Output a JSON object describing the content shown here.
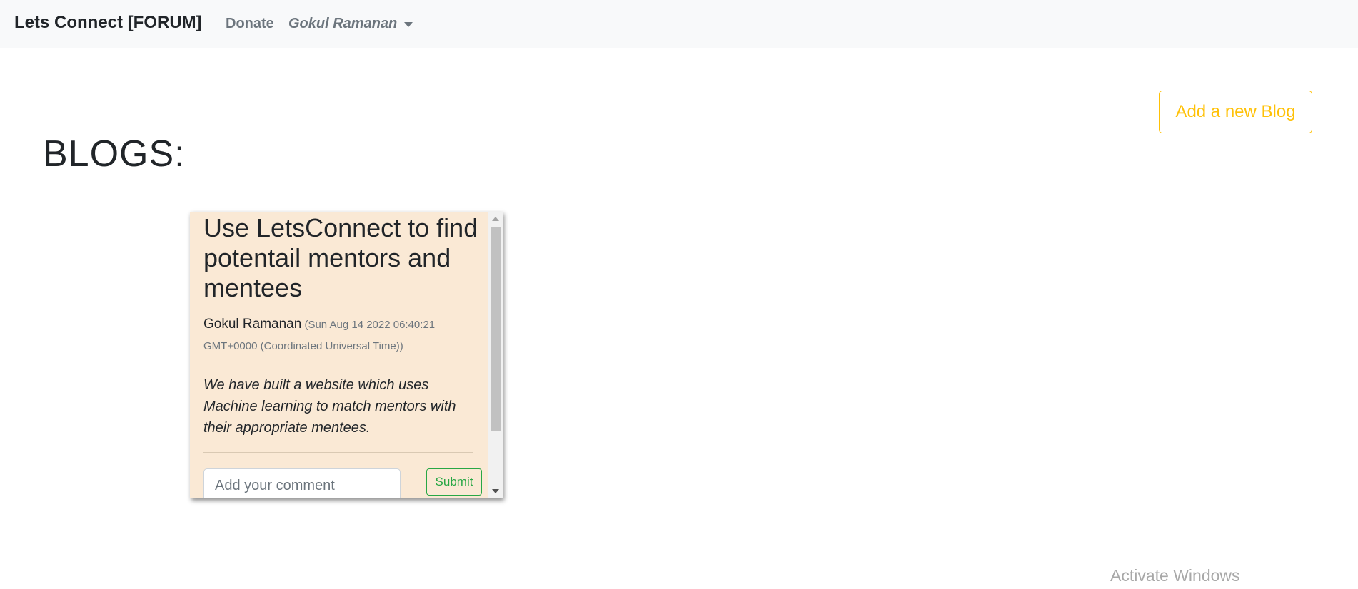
{
  "navbar": {
    "brand": "Lets Connect [FORUM]",
    "donate": "Donate",
    "user": "Gokul Ramanan"
  },
  "page": {
    "title": "BLOGS:",
    "add_blog_label": "Add a new Blog"
  },
  "blogs": [
    {
      "title": "Use LetsConnect to find potentail mentors and mentees",
      "author": "Gokul Ramanan",
      "timestamp": "(Sun Aug 14 2022 06:40:21 GMT+0000 (Coordinated Universal Time))",
      "body": "We have built a website which uses Machine learning to match mentors with their appropriate mentees.",
      "comment_placeholder": "Add your comment",
      "submit_label": "Submit"
    }
  ],
  "watermark": "Activate Windows",
  "colors": {
    "navbar_bg": "#f8f9fa",
    "card_bg": "#fae9d5",
    "warning": "#ffc107",
    "success": "#28a745"
  }
}
